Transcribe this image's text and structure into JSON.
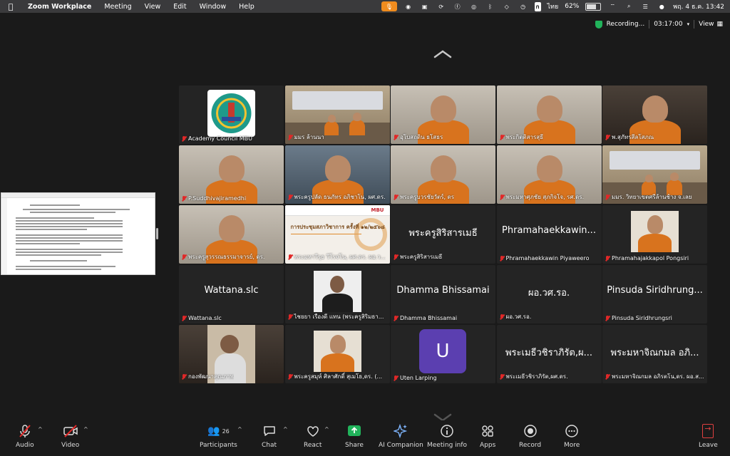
{
  "menubar": {
    "app": "Zoom Workplace",
    "items": [
      "Meeting",
      "View",
      "Edit",
      "Window",
      "Help"
    ],
    "battery": "62%",
    "input_lang": "ไทย",
    "datetime": "พฤ. 4 ธ.ค.  13:42"
  },
  "topbar": {
    "recording": "Recording...",
    "timer": "03:17:00",
    "view": "View"
  },
  "participants": [
    {
      "name": "Academy Council MBU",
      "type": "logo"
    },
    {
      "name": "มมร ล้านนา",
      "type": "video",
      "scene": "room"
    },
    {
      "name": "อุโบสถดิน ธโสธร",
      "type": "video",
      "scene": "monk"
    },
    {
      "name": "พระกิตติสารสุธี",
      "type": "video",
      "scene": "monk"
    },
    {
      "name": "พ.สุภัทรสีลโสภณ",
      "type": "video",
      "scene": "monk-dark"
    },
    {
      "name": "P.Suddhivajiramedhi",
      "type": "video",
      "scene": "monk"
    },
    {
      "name": "พระครูปลัด ธนภัทร อภิชาโน, ผศ.ดร.",
      "type": "video",
      "scene": "monk-blue"
    },
    {
      "name": "พระครูบวรชัยวัตร์, ดร",
      "type": "video",
      "scene": "monk"
    },
    {
      "name": "พระมหาศุภชัย สุภกิจโจ, รศ.ดร.",
      "type": "video",
      "scene": "monk"
    },
    {
      "name": "มมร. วิทยาเขตศรีล้านช้าง จ.เลย",
      "type": "video",
      "scene": "room"
    },
    {
      "name": "พระครูสุวรรณธรรมาจารย์, ดร.",
      "type": "video",
      "scene": "monk"
    },
    {
      "name": "พระมหาวีรุธ วีโรจโน, ผศ.ดร. ผอ.ว...",
      "type": "slide",
      "slide_title": "MBU",
      "slide_text": "การประชุมสภาวิชาการ ครั้งที่ ๑๒/๒๕๖๘"
    },
    {
      "name": "พระครูสิริสารเมธี",
      "type": "text",
      "display": "พระครูสิริสารเมธี"
    },
    {
      "name": "Phramahaekkawin Piyaweero",
      "type": "text",
      "display": "Phramahaekkawin..."
    },
    {
      "name": "Phramahajakkapol Pongsiri",
      "type": "avatar-monk"
    },
    {
      "name": "Wattana.slc",
      "type": "text",
      "display": "Wattana.slc"
    },
    {
      "name": "ไชยยา  เรืองดี แทน (พระครูสิริมธา...",
      "type": "avatar-person"
    },
    {
      "name": "Dhamma Bhissamai",
      "type": "text",
      "display": "Dhamma Bhissamai"
    },
    {
      "name": "ผอ.วศ.รอ.",
      "type": "text",
      "display": "ผอ.วศ.รอ."
    },
    {
      "name": "Pinsuda Siridhrungsri",
      "type": "text",
      "display": "Pinsuda Siridhrung..."
    },
    {
      "name": "กองพัฒนาคุณภาพ",
      "type": "video",
      "scene": "person"
    },
    {
      "name": "พระครูสมุห์ ศิลาศักดิ์ สุเมโธ,ดร. (...",
      "type": "avatar-monk"
    },
    {
      "name": "Uten Larping",
      "type": "initial",
      "initial": "U",
      "color": "#5b3fb0"
    },
    {
      "name": "พระเมธีวชิราภิรัต,ผศ.ดร.",
      "type": "text",
      "display": "พระเมธีวชิราภิรัต,ผ..."
    },
    {
      "name": "พระมหาจิณกมล อภิรตโน,ดร. ผอ.ส...",
      "type": "text",
      "display": "พระมหาจิณกมล อภิ..."
    }
  ],
  "toolbar": {
    "audio": "Audio",
    "video": "Video",
    "participants": "Participants",
    "participants_count": "26",
    "chat": "Chat",
    "react": "React",
    "share": "Share",
    "ai": "AI Companion",
    "info": "Meeting info",
    "apps": "Apps",
    "record": "Record",
    "more": "More",
    "leave": "Leave"
  },
  "colors": {
    "muted": "#e02828",
    "share_green": "#21b35b",
    "leave_red": "#e04040",
    "recording_shield": "#21b35b"
  }
}
